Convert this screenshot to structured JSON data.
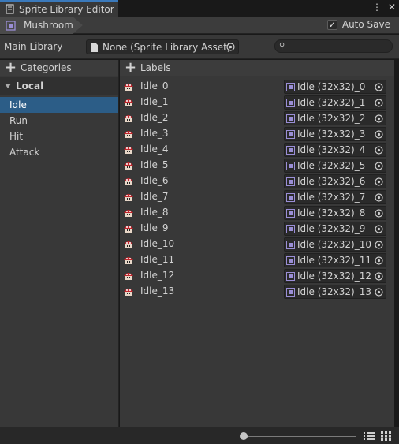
{
  "window": {
    "tab_title": "Sprite Library Editor",
    "menu_icon": "kebab-icon",
    "close_glyph": "✕"
  },
  "toolbar": {
    "breadcrumb": "Mushroom",
    "auto_save_label": "Auto Save",
    "auto_save_checked": true
  },
  "library": {
    "main_library_label": "Main Library",
    "main_library_value": "None (Sprite Library Asset)",
    "search_placeholder": ""
  },
  "categories": {
    "header": "Categories",
    "group": "Local",
    "items": [
      {
        "label": "Idle",
        "selected": true
      },
      {
        "label": "Run",
        "selected": false
      },
      {
        "label": "Hit",
        "selected": false
      },
      {
        "label": "Attack",
        "selected": false
      }
    ]
  },
  "labels": {
    "header": "Labels",
    "items": [
      {
        "name": "Idle_0",
        "sprite": "Idle (32x32)_0"
      },
      {
        "name": "Idle_1",
        "sprite": "Idle (32x32)_1"
      },
      {
        "name": "Idle_2",
        "sprite": "Idle (32x32)_2"
      },
      {
        "name": "Idle_3",
        "sprite": "Idle (32x32)_3"
      },
      {
        "name": "Idle_4",
        "sprite": "Idle (32x32)_4"
      },
      {
        "name": "Idle_5",
        "sprite": "Idle (32x32)_5"
      },
      {
        "name": "Idle_6",
        "sprite": "Idle (32x32)_6"
      },
      {
        "name": "Idle_7",
        "sprite": "Idle (32x32)_7"
      },
      {
        "name": "Idle_8",
        "sprite": "Idle (32x32)_8"
      },
      {
        "name": "Idle_9",
        "sprite": "Idle (32x32)_9"
      },
      {
        "name": "Idle_10",
        "sprite": "Idle (32x32)_10"
      },
      {
        "name": "Idle_11",
        "sprite": "Idle (32x32)_11"
      },
      {
        "name": "Idle_12",
        "sprite": "Idle (32x32)_12"
      },
      {
        "name": "Idle_13",
        "sprite": "Idle (32x32)_13"
      }
    ]
  },
  "footer": {
    "zoom_fraction": 0.0
  },
  "colors": {
    "accent": "#2c5d87",
    "tab_accent": "#3a79bb",
    "sprite_red": "#c0272d"
  }
}
